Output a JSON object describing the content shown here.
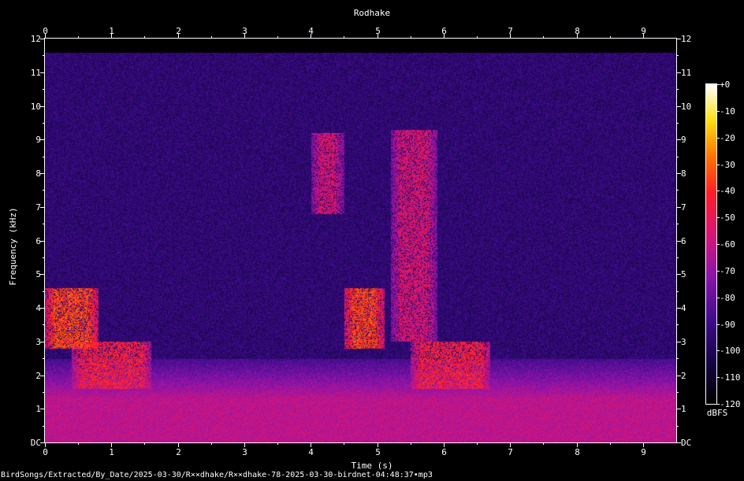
{
  "chart_data": {
    "type": "heatmap",
    "title": "Rodhake",
    "xlabel": "Time (s)",
    "ylabel": "Frequency (kHz)",
    "x_ticks": [
      "0",
      "1",
      "2",
      "3",
      "4",
      "5",
      "6",
      "7",
      "8",
      "9"
    ],
    "y_ticks": [
      "DC",
      "1",
      "2",
      "3",
      "4",
      "5",
      "6",
      "7",
      "8",
      "9",
      "10",
      "11",
      "12"
    ],
    "xlim": [
      0,
      9.5
    ],
    "ylim": [
      0,
      12
    ],
    "colorbar": {
      "unit": "dBFS",
      "ticks": [
        "+0",
        "-10",
        "-20",
        "-30",
        "-40",
        "-50",
        "-60",
        "-70",
        "-80",
        "-90",
        "-100",
        "-110",
        "-120"
      ],
      "range": [
        -120,
        0
      ]
    },
    "colormap": "black-indigo-magenta-red-yellow-white",
    "data_cutoff_khz": 11.6,
    "background_level_dbfs": -95,
    "low_band": {
      "freq_khz": [
        0,
        1.3
      ],
      "level_dbfs": -62
    },
    "events": [
      {
        "t": [
          0.0,
          0.8
        ],
        "f_khz": [
          2.8,
          4.6
        ],
        "peak_dbfs": -35
      },
      {
        "t": [
          0.4,
          1.6
        ],
        "f_khz": [
          1.6,
          3.0
        ],
        "peak_dbfs": -45
      },
      {
        "t": [
          4.0,
          4.5
        ],
        "f_khz": [
          6.8,
          9.2
        ],
        "peak_dbfs": -55
      },
      {
        "t": [
          4.5,
          5.1
        ],
        "f_khz": [
          2.8,
          4.6
        ],
        "peak_dbfs": -35
      },
      {
        "t": [
          5.2,
          5.9
        ],
        "f_khz": [
          3.0,
          9.3
        ],
        "peak_dbfs": -55
      },
      {
        "t": [
          5.5,
          6.7
        ],
        "f_khz": [
          1.6,
          3.0
        ],
        "peak_dbfs": -45
      }
    ]
  },
  "footer": {
    "path": "BirdSongs/Extracted/By_Date/2025-03-30/R××dhake/R××dhake-78-2025-03-30-birdnet-04:48:37•mp3"
  }
}
